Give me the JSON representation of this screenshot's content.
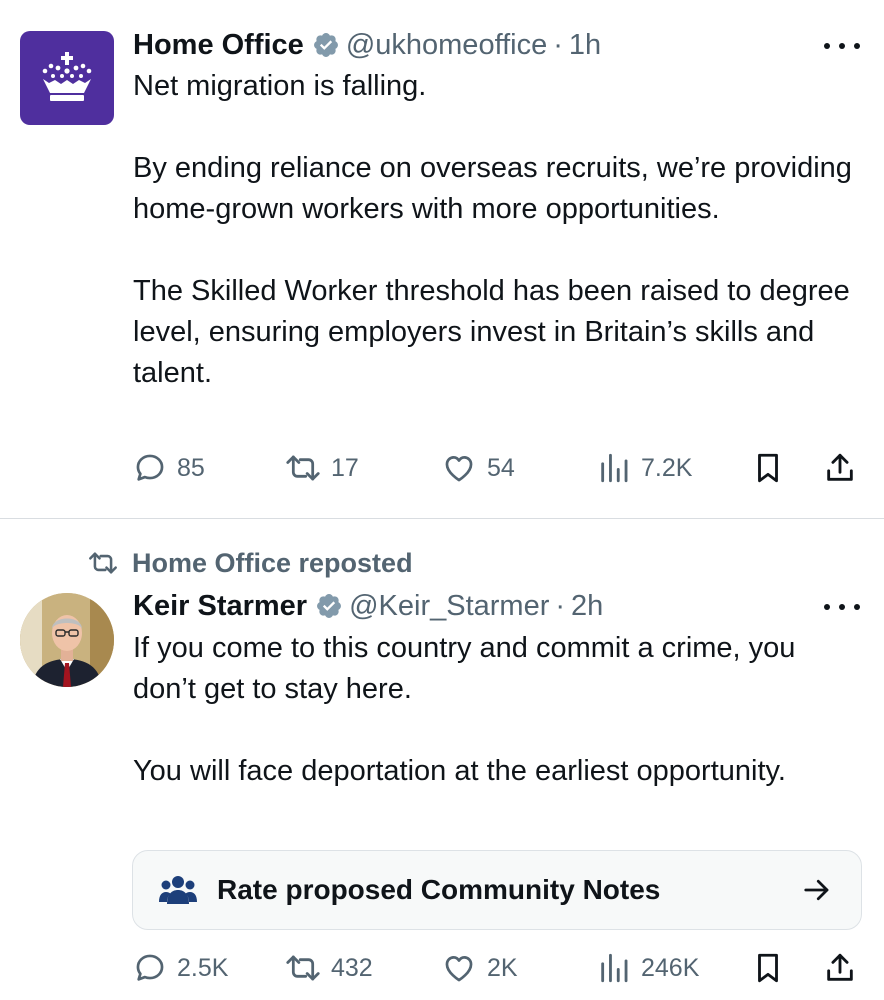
{
  "colors": {
    "text": "#0f1419",
    "secondary": "#536471",
    "verified_badge": "#829aab",
    "home_office_brand": "#4f2f9e",
    "community_notes_icon": "#1d3f7a",
    "divider": "#d9dde1"
  },
  "tweets": [
    {
      "author": {
        "name": "Home Office",
        "handle": "@ukhomeoffice",
        "verified": true,
        "avatar_icon": "crown-logo-icon"
      },
      "time": "1h",
      "paragraphs": [
        "Net migration is falling.",
        "By ending reliance on overseas recruits, we’re providing home-grown workers with more opportunities.",
        "The Skilled Worker threshold has been raised to degree level, ensuring employers invest in Britain’s skills and talent."
      ],
      "stats": {
        "replies": "85",
        "reposts": "17",
        "likes": "54",
        "views": "7.2K"
      }
    },
    {
      "reposted_by": "Home Office reposted",
      "author": {
        "name": "Keir Starmer",
        "handle": "@Keir_Starmer",
        "verified": true,
        "avatar_icon": "profile-photo"
      },
      "time": "2h",
      "paragraphs": [
        "If you come to this country and commit a crime, you don’t get to stay here.",
        "You will face deportation at the earliest opportunity."
      ],
      "community_notes": {
        "label": "Rate proposed Community Notes",
        "icon": "people-group-icon"
      },
      "stats": {
        "replies": "2.5K",
        "reposts": "432",
        "likes": "2K",
        "views": "246K"
      }
    }
  ]
}
